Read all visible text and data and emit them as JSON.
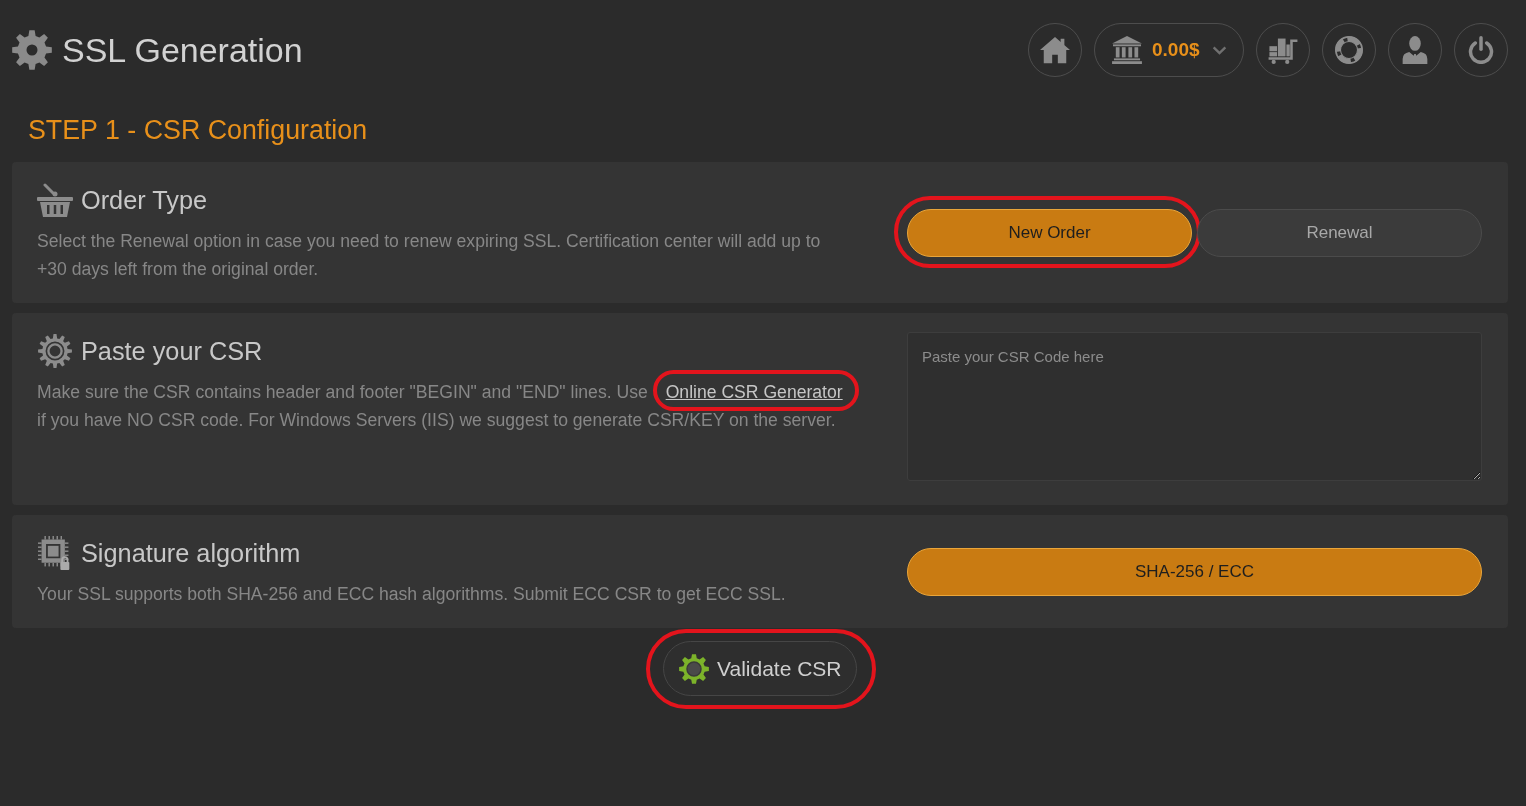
{
  "header": {
    "title": "SSL Generation",
    "balance": "0.00$"
  },
  "step_title": "STEP 1 - CSR Configuration",
  "sections": [
    {
      "kind": "order_type",
      "title": "Order Type",
      "description": "Select the Renewal option in case you need to renew expiring SSL. Certification center will add up to +30 days left from the original order.",
      "options": [
        {
          "label": "New Order",
          "selected": true,
          "highlighted": true
        },
        {
          "label": "Renewal",
          "selected": false,
          "highlighted": false
        }
      ]
    },
    {
      "kind": "csr",
      "title": "Paste your CSR",
      "description_before": "Make sure the CSR contains header and footer \"BEGIN\" and \"END\" lines. Use",
      "link": {
        "label": "Online CSR Generator",
        "highlighted": true
      },
      "description_after": "if you have NO CSR code. For Windows Servers (IIS) we suggest to generate CSR/KEY on the server.",
      "textarea": {
        "placeholder": "Paste your CSR Code here"
      }
    },
    {
      "kind": "signature",
      "title": "Signature algorithm",
      "description": "Your SSL supports both SHA-256 and ECC hash algorithms. Submit ECC CSR to get ECC SSL.",
      "options": [
        {
          "label": "SHA-256 / ECC",
          "selected": true,
          "highlighted": false
        }
      ]
    }
  ],
  "validate_button": {
    "label": "Validate CSR",
    "highlighted": true
  }
}
